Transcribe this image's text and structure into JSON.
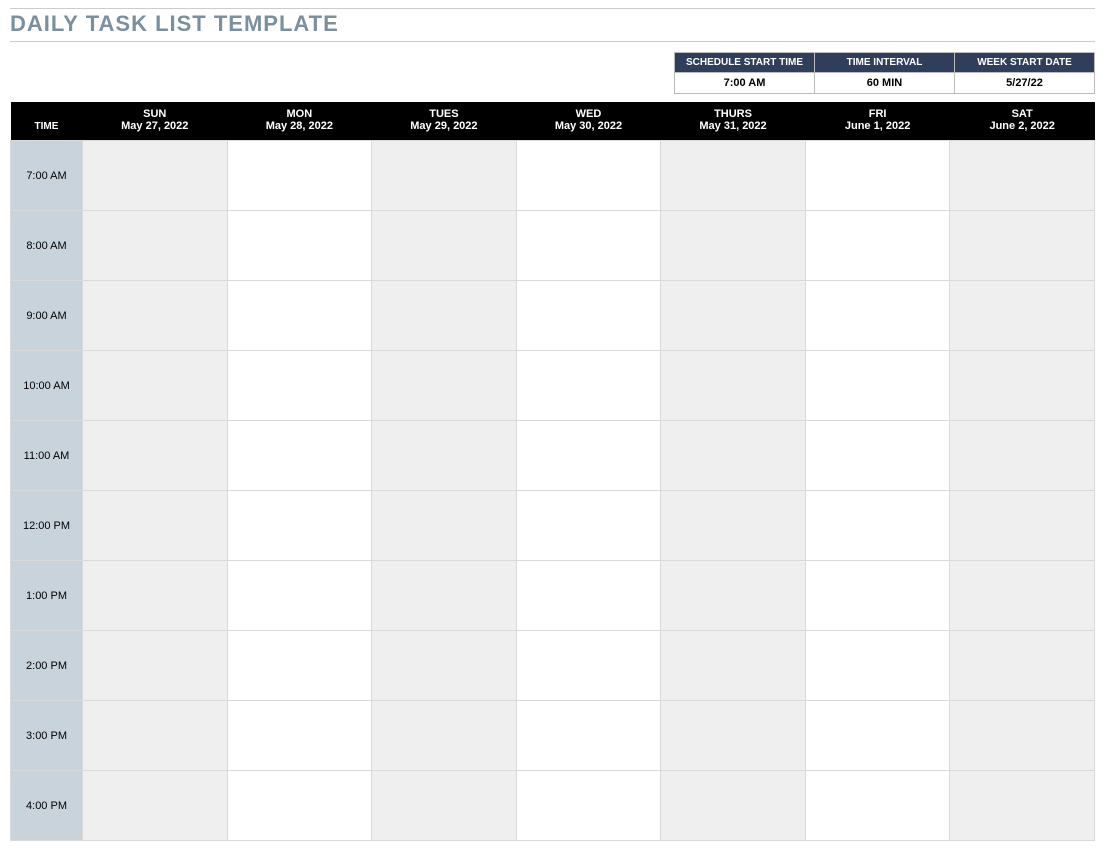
{
  "title": "DAILY TASK LIST TEMPLATE",
  "settings": {
    "headers": {
      "start_time": "SCHEDULE START TIME",
      "interval": "TIME INTERVAL",
      "week_start": "WEEK START DATE"
    },
    "values": {
      "start_time": "7:00 AM",
      "interval": "60 MIN",
      "week_start": "5/27/22"
    }
  },
  "schedule": {
    "time_header": "TIME",
    "days": [
      {
        "dow": "SUN",
        "date": "May 27, 2022"
      },
      {
        "dow": "MON",
        "date": "May 28, 2022"
      },
      {
        "dow": "TUES",
        "date": "May 29, 2022"
      },
      {
        "dow": "WED",
        "date": "May 30, 2022"
      },
      {
        "dow": "THURS",
        "date": "May 31, 2022"
      },
      {
        "dow": "FRI",
        "date": "June 1, 2022"
      },
      {
        "dow": "SAT",
        "date": "June 2, 2022"
      }
    ],
    "times": [
      "7:00 AM",
      "8:00 AM",
      "9:00 AM",
      "10:00 AM",
      "11:00 AM",
      "12:00 PM",
      "1:00 PM",
      "2:00 PM",
      "3:00 PM",
      "4:00 PM"
    ]
  }
}
